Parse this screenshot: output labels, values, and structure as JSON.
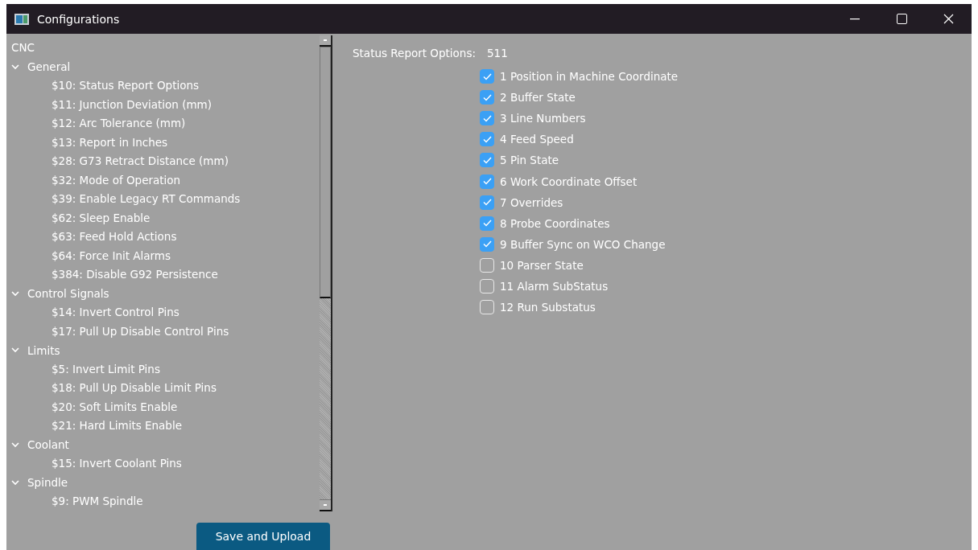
{
  "window": {
    "title": "Configurations"
  },
  "tree": {
    "root": "CNC",
    "groups": [
      {
        "label": "General",
        "expanded": true,
        "children": [
          {
            "label": "$10: Status Report Options"
          },
          {
            "label": "$11: Junction Deviation (mm)"
          },
          {
            "label": "$12: Arc Tolerance (mm)"
          },
          {
            "label": "$13: Report in Inches"
          },
          {
            "label": "$28: G73 Retract Distance (mm)"
          },
          {
            "label": "$32: Mode of Operation"
          },
          {
            "label": "$39: Enable Legacy RT Commands"
          },
          {
            "label": "$62: Sleep Enable"
          },
          {
            "label": "$63: Feed Hold Actions"
          },
          {
            "label": "$64: Force Init Alarms"
          },
          {
            "label": "$384: Disable G92 Persistence"
          }
        ]
      },
      {
        "label": "Control Signals",
        "expanded": true,
        "children": [
          {
            "label": "$14: Invert Control Pins"
          },
          {
            "label": "$17: Pull Up Disable Control Pins"
          }
        ]
      },
      {
        "label": "Limits",
        "expanded": true,
        "children": [
          {
            "label": "$5: Invert Limit Pins"
          },
          {
            "label": "$18: Pull Up Disable Limit Pins"
          },
          {
            "label": "$20: Soft Limits Enable"
          },
          {
            "label": "$21: Hard Limits Enable"
          }
        ]
      },
      {
        "label": "Coolant",
        "expanded": true,
        "children": [
          {
            "label": "$15: Invert Coolant Pins"
          }
        ]
      },
      {
        "label": "Spindle",
        "expanded": true,
        "children": [
          {
            "label": "$9: PWM Spindle"
          }
        ]
      }
    ]
  },
  "save_button": "Save and Upload",
  "setting": {
    "label": "Status Report Options:",
    "value": "511",
    "options": [
      {
        "label": "1 Position in Machine Coordinate",
        "checked": true
      },
      {
        "label": "2 Buffer State",
        "checked": true
      },
      {
        "label": "3 Line Numbers",
        "checked": true
      },
      {
        "label": "4 Feed  Speed",
        "checked": true
      },
      {
        "label": "5 Pin State",
        "checked": true
      },
      {
        "label": "6 Work Coordinate Offset",
        "checked": true
      },
      {
        "label": "7 Overrides",
        "checked": true
      },
      {
        "label": "8 Probe Coordinates",
        "checked": true
      },
      {
        "label": "9 Buffer Sync on WCO Change",
        "checked": true
      },
      {
        "label": "10 Parser State",
        "checked": false
      },
      {
        "label": "11 Alarm SubStatus",
        "checked": false
      },
      {
        "label": "12 Run Substatus",
        "checked": false
      }
    ]
  }
}
